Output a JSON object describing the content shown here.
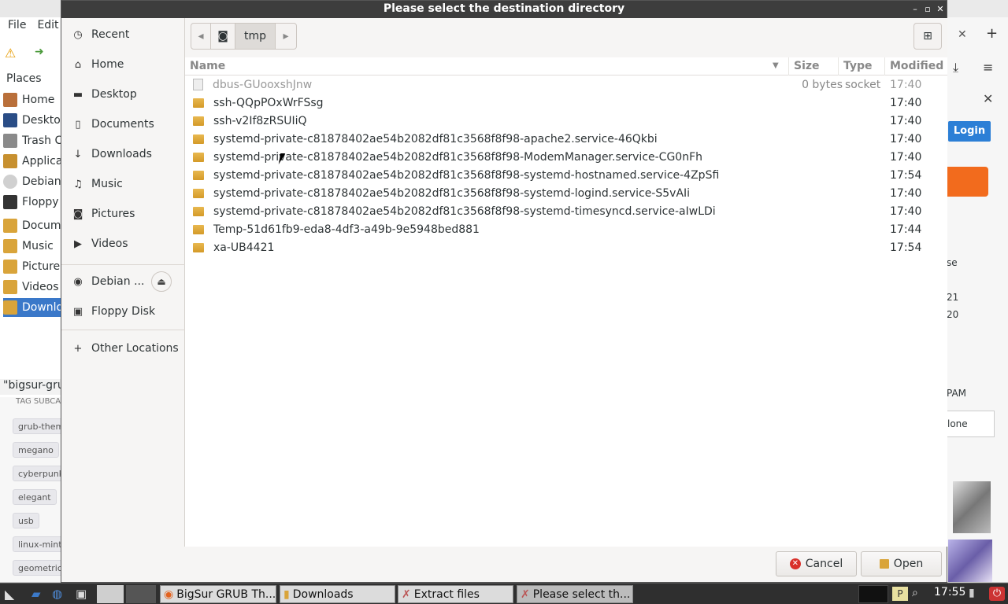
{
  "dialog": {
    "title": "Please select the destination directory",
    "path": {
      "current": "tmp"
    },
    "columns": {
      "name": "Name",
      "size": "Size",
      "type": "Type",
      "modified": "Modified"
    },
    "sidebar": [
      {
        "label": "Recent",
        "icon": "clock-icon"
      },
      {
        "label": "Home",
        "icon": "home-icon"
      },
      {
        "label": "Desktop",
        "icon": "folder-icon"
      },
      {
        "label": "Documents",
        "icon": "document-icon"
      },
      {
        "label": "Downloads",
        "icon": "download-icon"
      },
      {
        "label": "Music",
        "icon": "music-icon"
      },
      {
        "label": "Pictures",
        "icon": "camera-icon"
      },
      {
        "label": "Videos",
        "icon": "video-icon"
      }
    ],
    "devices": [
      {
        "label": "Debian ...",
        "icon": "disc-icon"
      },
      {
        "label": "Floppy Disk",
        "icon": "floppy-icon"
      }
    ],
    "other_locations": "Other Locations",
    "files": [
      {
        "name": "dbus-GUooxshJnw",
        "size": "0 bytes",
        "type": "socket",
        "modified": "17:40",
        "kind": "socket"
      },
      {
        "name": "ssh-QQpPOxWrFSsg",
        "size": "",
        "type": "",
        "modified": "17:40",
        "kind": "folder"
      },
      {
        "name": "ssh-v2If8zRSUIiQ",
        "size": "",
        "type": "",
        "modified": "17:40",
        "kind": "folder"
      },
      {
        "name": "systemd-private-c81878402ae54b2082df81c3568f8f98-apache2.service-46Qkbi",
        "size": "",
        "type": "",
        "modified": "17:40",
        "kind": "folder"
      },
      {
        "name": "systemd-private-c81878402ae54b2082df81c3568f8f98-ModemManager.service-CG0nFh",
        "size": "",
        "type": "",
        "modified": "17:40",
        "kind": "folder"
      },
      {
        "name": "systemd-private-c81878402ae54b2082df81c3568f8f98-systemd-hostnamed.service-4ZpSfi",
        "size": "",
        "type": "",
        "modified": "17:54",
        "kind": "folder"
      },
      {
        "name": "systemd-private-c81878402ae54b2082df81c3568f8f98-systemd-logind.service-S5vAIi",
        "size": "",
        "type": "",
        "modified": "17:40",
        "kind": "folder"
      },
      {
        "name": "systemd-private-c81878402ae54b2082df81c3568f8f98-systemd-timesyncd.service-aIwLDi",
        "size": "",
        "type": "",
        "modified": "17:40",
        "kind": "folder"
      },
      {
        "name": "Temp-51d61fb9-eda8-4df3-a49b-9e5948bed881",
        "size": "",
        "type": "",
        "modified": "17:44",
        "kind": "folder"
      },
      {
        "name": "xa-UB4421",
        "size": "",
        "type": "",
        "modified": "17:54",
        "kind": "folder"
      }
    ],
    "cancel_label": "Cancel",
    "open_label": "Open"
  },
  "bg_filemanager": {
    "menu": [
      "File",
      "Edit"
    ],
    "places_header": "Places",
    "places": [
      "Home",
      "Deskto",
      "Trash C",
      "Applica",
      "Debian",
      "Floppy",
      "Docum",
      "Music",
      "Picture",
      "Videos",
      "Downlo"
    ],
    "status": "\"bigsur-gru"
  },
  "bg_browser": {
    "tag_header": "TAG SUBCA",
    "tags": [
      "grub-theme",
      "megano",
      "cyberpunk",
      "elegant",
      "usb",
      "linux-mint",
      "geometric"
    ],
    "login_label": "Login",
    "side_texts": [
      "se",
      "21",
      "20",
      "PAM",
      "lone"
    ]
  },
  "taskbar": {
    "items": [
      "BigSur GRUB Th...",
      "Downloads",
      "Extract files",
      "Please select th..."
    ],
    "clock": "17:55"
  },
  "colors": {
    "accent": "#3a78c9",
    "cancel_red": "#d9302a",
    "titlebar": "#3d3d3d",
    "login_blue": "#2c7fd6",
    "orange": "#f26b1d"
  }
}
